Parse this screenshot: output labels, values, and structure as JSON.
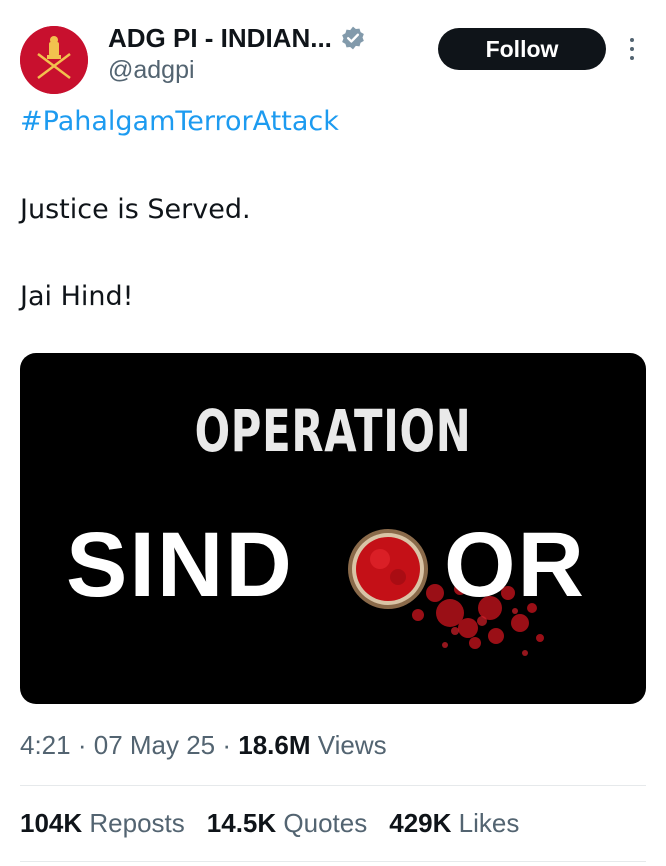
{
  "author": {
    "display_name": "ADG PI - INDIAN...",
    "handle": "@adgpi",
    "avatar_icon": "indian-army-emblem-icon",
    "avatar_color": "#c8102e",
    "verified_icon": "verified-badge-icon",
    "verified_color": "#829aab"
  },
  "actions": {
    "follow_label": "Follow",
    "more_icon": "more-vertical-icon"
  },
  "tweet": {
    "hashtag": "#PahalgamTerrorAttack",
    "line1": "Justice is Served.",
    "line2": "Jai Hind!"
  },
  "media": {
    "title_top": "OPERATION",
    "title_bottom_start": "SIND",
    "title_bottom_end": "OR",
    "bowl_icon": "sindoor-bowl-icon",
    "background": "#000000",
    "accent": "#c4101a"
  },
  "meta": {
    "time": "4:21",
    "date": "07 May 25",
    "views_count": "18.6M",
    "views_label": "Views"
  },
  "stats": {
    "reposts_count": "104K",
    "reposts_label": "Reposts",
    "quotes_count": "14.5K",
    "quotes_label": "Quotes",
    "likes_count": "429K",
    "likes_label": "Likes"
  },
  "colors": {
    "link": "#1d9bf0",
    "text": "#0f1419",
    "secondary": "#536471"
  }
}
